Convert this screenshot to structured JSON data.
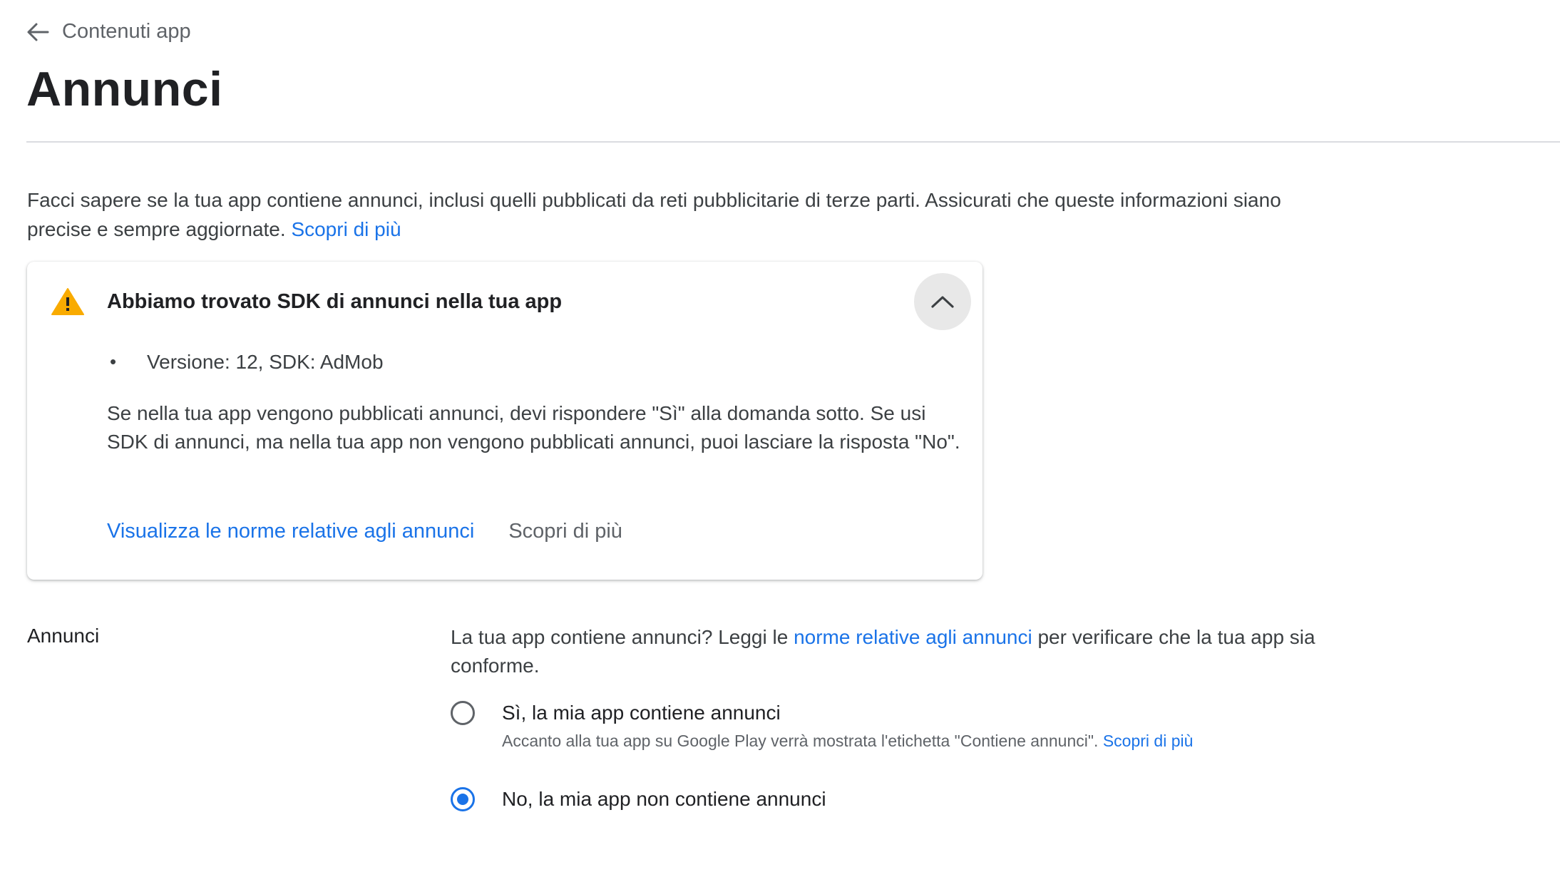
{
  "header": {
    "back_label": "Contenuti app",
    "title": "Annunci"
  },
  "intro": {
    "text": "Facci sapere se la tua app contiene annunci, inclusi quelli pubblicati da reti pubblicitarie di terze parti. Assicurati che queste informazioni siano precise e sempre aggiornate. ",
    "link": "Scopri di più"
  },
  "warning_card": {
    "title": "Abbiamo trovato SDK di annunci nella tua app",
    "sdk_items": [
      "Versione: 12, SDK: AdMob"
    ],
    "body": "Se nella tua app vengono pubblicati annunci, devi rispondere \"Sì\" alla domanda sotto. Se usi SDK di annunci, ma nella tua app non vengono pubblicati annunci, puoi lasciare la risposta \"No\".",
    "policy_link": "Visualizza le norme relative agli annunci",
    "learn_more": "Scopri di più",
    "warning_color": "#f9ab00"
  },
  "ads_section": {
    "label": "Annunci",
    "question_prefix": "La tua app contiene annunci? Leggi le ",
    "question_link": "norme relative agli annunci",
    "question_suffix": " per verificare che la tua app sia conforme.",
    "options": [
      {
        "label": "Sì, la mia app contiene annunci",
        "help": "Accanto alla tua app su Google Play verrà mostrata l'etichetta \"Contiene annunci\". ",
        "help_link": "Scopri di più",
        "selected": false
      },
      {
        "label": "No, la mia app non contiene annunci",
        "selected": true
      }
    ]
  },
  "colors": {
    "accent": "#1a73e8",
    "text_primary": "#202124",
    "text_secondary": "#5f6368"
  }
}
